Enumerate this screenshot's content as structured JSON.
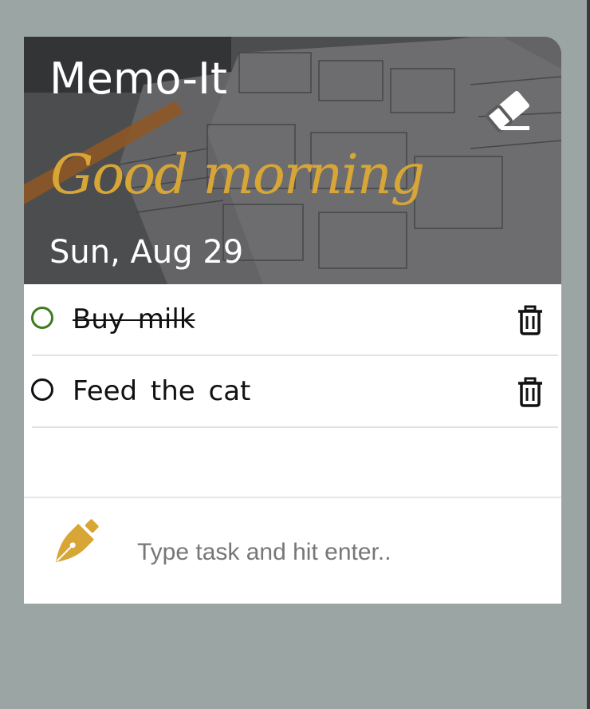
{
  "header": {
    "app_title": "Memo-It",
    "greeting": "Good morning",
    "date": "Sun, Aug 29"
  },
  "icons": {
    "clear_all": "eraser-icon",
    "delete": "trash-icon",
    "compose": "fountain-pen-icon"
  },
  "tasks": [
    {
      "label": "Buy milk",
      "completed": true
    },
    {
      "label": "Feed the cat",
      "completed": false
    }
  ],
  "new_task": {
    "placeholder": "Type task and hit enter..",
    "value": ""
  },
  "colors": {
    "page_background": "#9ba5a4",
    "greeting": "#d8a636",
    "completed_check": "#3f7a1f",
    "pen": "#d8a636"
  }
}
